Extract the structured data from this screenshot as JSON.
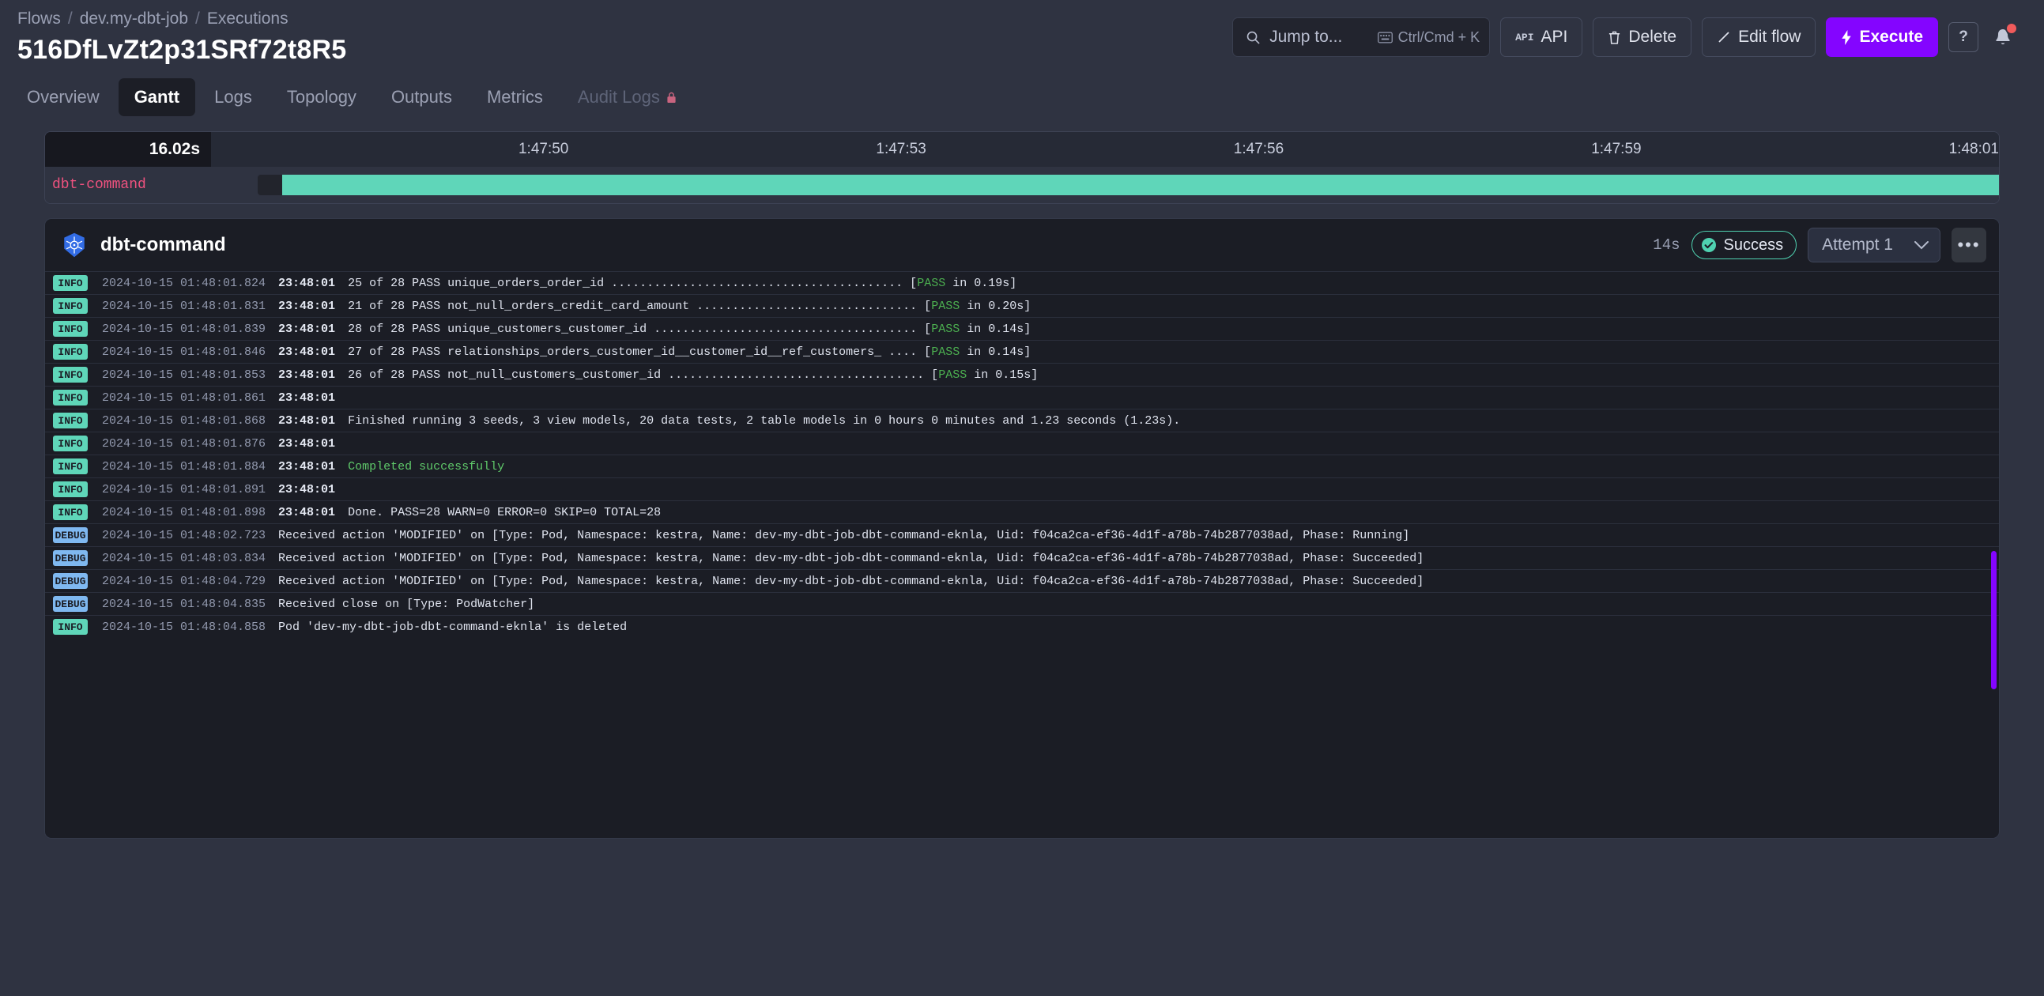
{
  "header": {
    "breadcrumb": [
      "Flows",
      "dev.my-dbt-job",
      "Executions"
    ],
    "separator": "/",
    "title": "516DfLvZt2p31SRf72t8R5",
    "search": {
      "placeholder": "Jump to...",
      "shortcut": "Ctrl/Cmd + K",
      "icon": "search-icon"
    },
    "buttons": [
      {
        "label": "API",
        "icon": "api-icon"
      },
      {
        "label": "Delete",
        "icon": "trash-icon"
      },
      {
        "label": "Edit flow",
        "icon": "pencil-icon"
      },
      {
        "label": "Execute",
        "icon": "lightning-icon",
        "accent": "#8405ff"
      }
    ],
    "help_label": "?",
    "bell_icon": "bell-icon"
  },
  "tabs": [
    {
      "label": "Overview",
      "active": false
    },
    {
      "label": "Gantt",
      "active": true
    },
    {
      "label": "Logs",
      "active": false
    },
    {
      "label": "Topology",
      "active": false
    },
    {
      "label": "Outputs",
      "active": false
    },
    {
      "label": "Metrics",
      "active": false
    },
    {
      "label": "Audit Logs",
      "active": false,
      "disabled": true,
      "icon": "lock-icon"
    }
  ],
  "gantt": {
    "duration": "16.02s",
    "ticks": [
      "1:47:50",
      "1:47:53",
      "1:47:56",
      "1:47:59",
      "1:48:01"
    ],
    "rows": [
      {
        "label": "dbt-command",
        "queued_pct": 1.4,
        "start_pct": 2.6,
        "width_pct": 97.4,
        "color": "#5fd6b9"
      }
    ]
  },
  "task": {
    "icon": "kubernetes-icon",
    "name": "dbt-command",
    "duration": "14s",
    "status": "Success",
    "status_icon": "check-circle-icon",
    "attempt": "Attempt 1",
    "attempt_chevron": "chevron-down-icon",
    "menu": "•••"
  },
  "logs": [
    {
      "level": "INFO",
      "ts": "2024-10-15 01:48:01.824",
      "time": "23:48:01",
      "msg": "25 of 28 PASS unique_orders_order_id ......................................... [",
      "tag": "PASS",
      "tail": " in 0.19s]"
    },
    {
      "level": "INFO",
      "ts": "2024-10-15 01:48:01.831",
      "time": "23:48:01",
      "msg": "21 of 28 PASS not_null_orders_credit_card_amount ............................... [",
      "tag": "PASS",
      "tail": " in 0.20s]"
    },
    {
      "level": "INFO",
      "ts": "2024-10-15 01:48:01.839",
      "time": "23:48:01",
      "msg": "28 of 28 PASS unique_customers_customer_id ..................................... [",
      "tag": "PASS",
      "tail": " in 0.14s]"
    },
    {
      "level": "INFO",
      "ts": "2024-10-15 01:48:01.846",
      "time": "23:48:01",
      "msg": "27 of 28 PASS relationships_orders_customer_id__customer_id__ref_customers_ .... [",
      "tag": "PASS",
      "tail": " in 0.14s]"
    },
    {
      "level": "INFO",
      "ts": "2024-10-15 01:48:01.853",
      "time": "23:48:01",
      "msg": "26 of 28 PASS not_null_customers_customer_id .................................... [",
      "tag": "PASS",
      "tail": " in 0.15s]"
    },
    {
      "level": "INFO",
      "ts": "2024-10-15 01:48:01.861",
      "time": "23:48:01",
      "msg": "",
      "tag": "",
      "tail": ""
    },
    {
      "level": "INFO",
      "ts": "2024-10-15 01:48:01.868",
      "time": "23:48:01",
      "msg": "Finished running 3 seeds, 3 view models, 20 data tests, 2 table models in 0 hours 0 minutes and 1.23 seconds (1.23s).",
      "tag": "",
      "tail": ""
    },
    {
      "level": "INFO",
      "ts": "2024-10-15 01:48:01.876",
      "time": "23:48:01",
      "msg": "",
      "tag": "",
      "tail": ""
    },
    {
      "level": "INFO",
      "ts": "2024-10-15 01:48:01.884",
      "time": "23:48:01",
      "msg": "",
      "tag": "",
      "tail": "",
      "ok_msg": "Completed successfully"
    },
    {
      "level": "INFO",
      "ts": "2024-10-15 01:48:01.891",
      "time": "23:48:01",
      "msg": "",
      "tag": "",
      "tail": ""
    },
    {
      "level": "INFO",
      "ts": "2024-10-15 01:48:01.898",
      "time": "23:48:01",
      "msg": "Done. PASS=28 WARN=0 ERROR=0 SKIP=0 TOTAL=28",
      "tag": "",
      "tail": ""
    },
    {
      "level": "DEBUG",
      "ts": "2024-10-15 01:48:02.723",
      "time": "",
      "msg": "Received action 'MODIFIED' on [Type: Pod, Namespace: kestra, Name: dev-my-dbt-job-dbt-command-eknla, Uid: f04ca2ca-ef36-4d1f-a78b-74b2877038ad, Phase: Running]",
      "tag": "",
      "tail": ""
    },
    {
      "level": "DEBUG",
      "ts": "2024-10-15 01:48:03.834",
      "time": "",
      "msg": "Received action 'MODIFIED' on [Type: Pod, Namespace: kestra, Name: dev-my-dbt-job-dbt-command-eknla, Uid: f04ca2ca-ef36-4d1f-a78b-74b2877038ad, Phase: Succeeded]",
      "tag": "",
      "tail": ""
    },
    {
      "level": "DEBUG",
      "ts": "2024-10-15 01:48:04.729",
      "time": "",
      "msg": "Received action 'MODIFIED' on [Type: Pod, Namespace: kestra, Name: dev-my-dbt-job-dbt-command-eknla, Uid: f04ca2ca-ef36-4d1f-a78b-74b2877038ad, Phase: Succeeded]",
      "tag": "",
      "tail": ""
    },
    {
      "level": "DEBUG",
      "ts": "2024-10-15 01:48:04.835",
      "time": "",
      "msg": "Received close on [Type: PodWatcher]",
      "tag": "",
      "tail": ""
    },
    {
      "level": "INFO",
      "ts": "2024-10-15 01:48:04.858",
      "time": "",
      "msg": "Pod 'dev-my-dbt-job-dbt-command-eknla' is deleted",
      "tag": "",
      "tail": ""
    }
  ],
  "colors": {
    "accent": "#8405ff",
    "success": "#5fd6b9",
    "debug": "#7fb8f0",
    "task_label": "#f0527f",
    "pass": "#4caf50"
  }
}
